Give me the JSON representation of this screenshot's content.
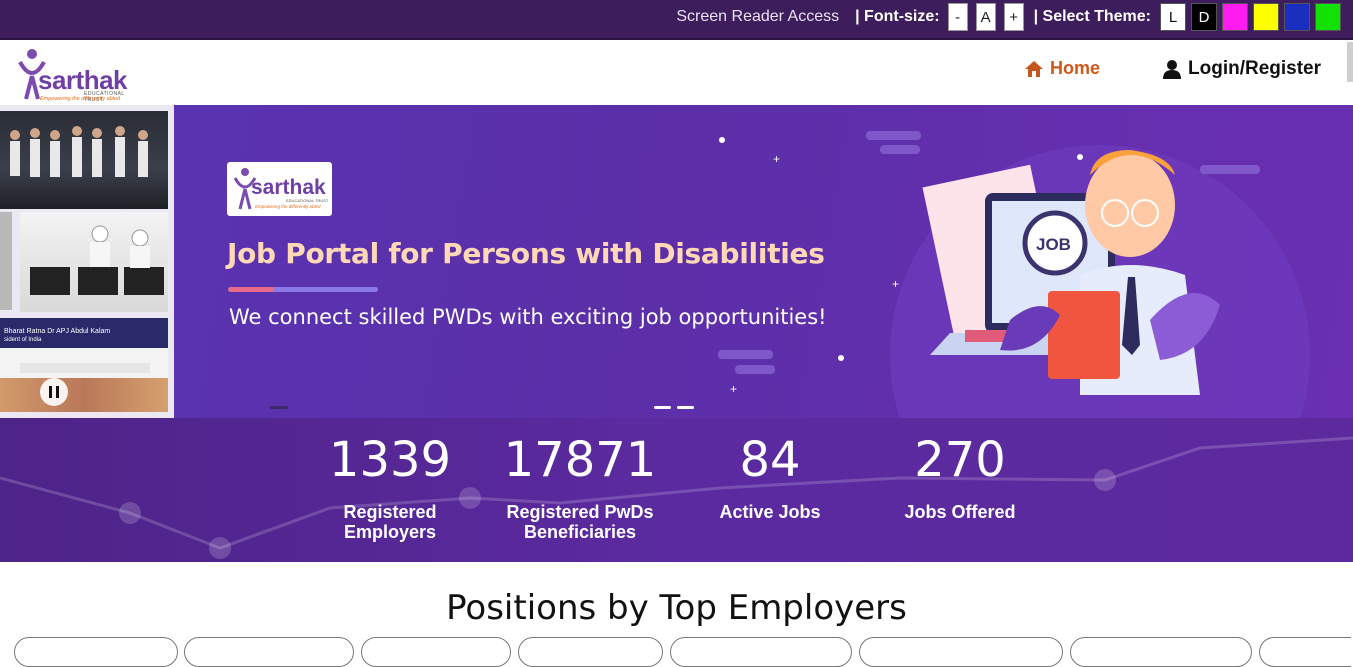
{
  "topbar": {
    "screen_reader": "Screen Reader Access",
    "font_size_label": "| Font-size:",
    "font_buttons": [
      "-",
      "A",
      "+"
    ],
    "theme_label": "| Select Theme:",
    "themes": [
      {
        "label": "L",
        "color": "#ffffff"
      },
      {
        "label": "D",
        "color": "#000000"
      },
      {
        "label": "",
        "color": "#ff1cf0"
      },
      {
        "label": "",
        "color": "#ffff00"
      },
      {
        "label": "",
        "color": "#1a2fbf"
      },
      {
        "label": "",
        "color": "#12e000"
      }
    ]
  },
  "header": {
    "logo_text": "sarthak",
    "logo_sub": "EDUCATIONAL TRUST",
    "logo_tagline": "Empowering the differently abled",
    "nav": {
      "home": "Home",
      "login": "Login/Register"
    }
  },
  "banner": {
    "title": "Job Portal for Persons with Disabilities",
    "subtitle": "We connect skilled PWDs with exciting job opportunities!",
    "logo_text": "sarthak",
    "logo_sub": "EDUCATIONAL TRUST",
    "logo_tagline": "Empowering the differently abled",
    "collage_caption": "Bharat Ratna Dr APJ Abdul Kalam",
    "collage_caption2": "sident of India",
    "illustration_badge": "JOB"
  },
  "stats": [
    {
      "value": "1339",
      "label": "Registered Employers"
    },
    {
      "value": "17871",
      "label": "Registered PwDs Beneficiaries"
    },
    {
      "value": "84",
      "label": "Active Jobs"
    },
    {
      "value": "270",
      "label": "Jobs Offered"
    }
  ],
  "positions": {
    "title": "Positions by Top Employers"
  },
  "colors": {
    "topbar": "#3d1d5c",
    "brand_purple": "#6f3fa6",
    "home_orange": "#d0571a",
    "banner_title": "#ffd9b5"
  }
}
